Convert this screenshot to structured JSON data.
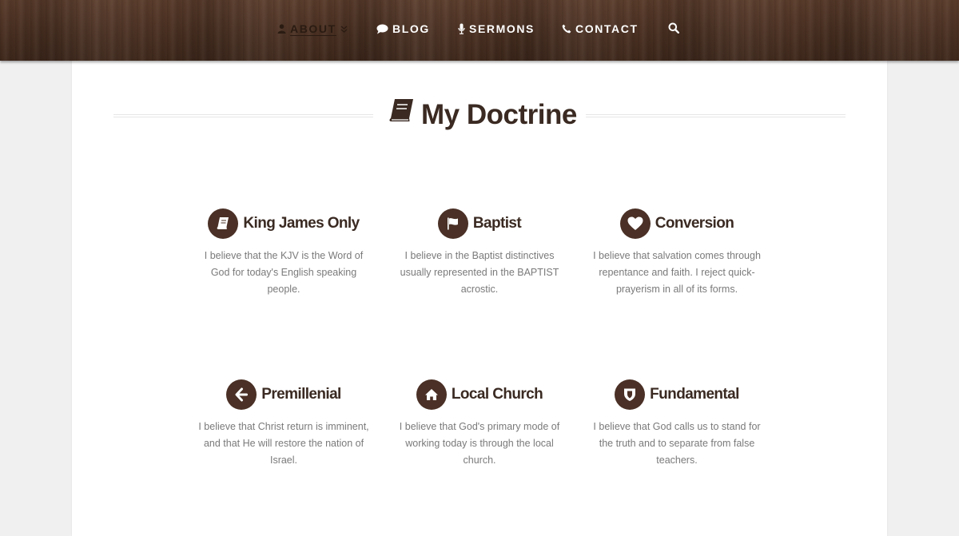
{
  "nav": {
    "items": [
      {
        "label": "About",
        "icon": "user-icon",
        "active": true,
        "has_dropdown": true
      },
      {
        "label": "Blog",
        "icon": "chat-bubble-icon"
      },
      {
        "label": "Sermons",
        "icon": "microphone-icon"
      },
      {
        "label": "Contact",
        "icon": "phone-icon"
      }
    ],
    "search_icon": "search-icon"
  },
  "page": {
    "title": "My Doctrine",
    "title_icon": "book-icon"
  },
  "features": [
    {
      "icon": "bible-icon",
      "title": "King James Only",
      "text": "I believe that the KJV is the Word of God for today's English speaking people."
    },
    {
      "icon": "flag-icon",
      "title": "Baptist",
      "text": "I believe in the Baptist distinctives usually represented in the BAPTIST acrostic."
    },
    {
      "icon": "heart-icon",
      "title": "Conversion",
      "text": "I believe that salvation comes through repentance and faith. I reject quick-prayerism in all of its forms."
    },
    {
      "icon": "arrow-left-icon",
      "title": "Premillenial",
      "text": "I believe that Christ return is imminent, and that He will restore the nation of Israel."
    },
    {
      "icon": "home-icon",
      "title": "Local Church",
      "text": "I believe that God's primary mode of working today is through the local church."
    },
    {
      "icon": "shield-icon",
      "title": "Fundamental",
      "text": "I believe that God calls us to stand for the truth and to separate from false teachers."
    }
  ],
  "colors": {
    "header_wood": "#4a3022",
    "accent_brown": "#4a3026",
    "heading_text": "#3a2a22",
    "body_text": "#7a7a7a",
    "page_bg": "#f0f0f0"
  }
}
